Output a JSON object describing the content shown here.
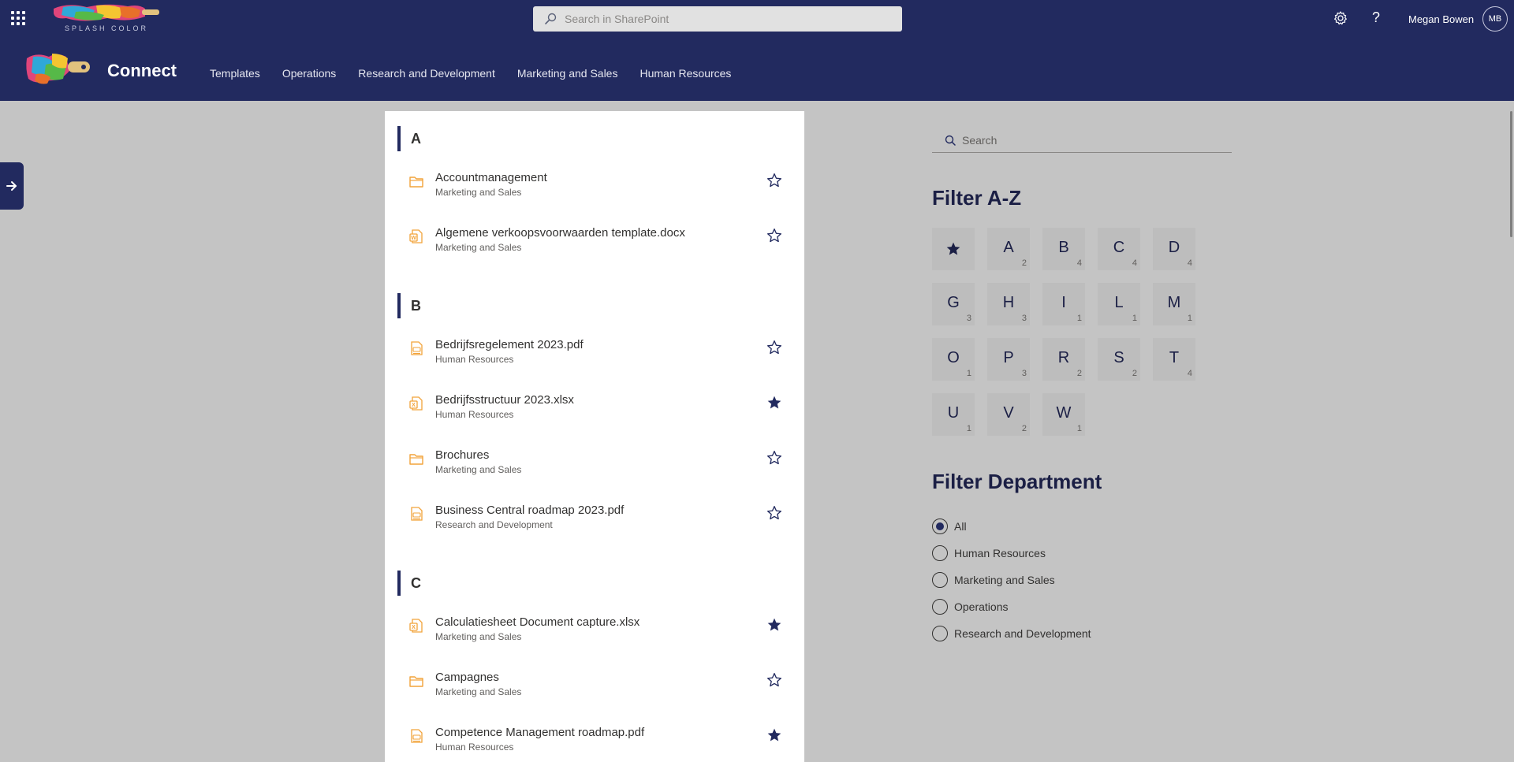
{
  "suite": {
    "brand": "SPLASH COLOR",
    "search_placeholder": "Search in SharePoint",
    "user_name": "Megan Bowen",
    "user_initials": "MB"
  },
  "site": {
    "title": "Connect",
    "nav": [
      "Templates",
      "Operations",
      "Research and Development",
      "Marketing and Sales",
      "Human Resources"
    ]
  },
  "colors": {
    "brand": "#222a5f",
    "file_icon": "#f2a33a",
    "page_bg": "#c4c4c4"
  },
  "groups": [
    {
      "letter": "A",
      "items": [
        {
          "name": "Accountmanagement",
          "dept": "Marketing and Sales",
          "icon": "folder-icon",
          "favorite": false
        },
        {
          "name": "Algemene verkoopsvoorwaarden template.docx",
          "dept": "Marketing and Sales",
          "icon": "word-doc-icon",
          "favorite": false
        }
      ]
    },
    {
      "letter": "B",
      "items": [
        {
          "name": "Bedrijfsregelement 2023.pdf",
          "dept": "Human Resources",
          "icon": "pdf-icon",
          "favorite": false
        },
        {
          "name": "Bedrijfsstructuur 2023.xlsx",
          "dept": "Human Resources",
          "icon": "excel-icon",
          "favorite": true
        },
        {
          "name": "Brochures",
          "dept": "Marketing and Sales",
          "icon": "folder-icon",
          "favorite": false
        },
        {
          "name": "Business Central roadmap 2023.pdf",
          "dept": "Research and Development",
          "icon": "pdf-icon",
          "favorite": false
        }
      ]
    },
    {
      "letter": "C",
      "items": [
        {
          "name": "Calculatiesheet Document capture.xlsx",
          "dept": "Marketing and Sales",
          "icon": "excel-icon",
          "favorite": true
        },
        {
          "name": "Campagnes",
          "dept": "Marketing and Sales",
          "icon": "folder-icon",
          "favorite": false
        },
        {
          "name": "Competence Management roadmap.pdf",
          "dept": "Human Resources",
          "icon": "pdf-icon",
          "favorite": true
        }
      ]
    }
  ],
  "filter": {
    "search_placeholder": "Search",
    "az_title": "Filter A-Z",
    "favorites_icon": "star-filled-icon",
    "letters": [
      {
        "letter": "A",
        "count": "2"
      },
      {
        "letter": "B",
        "count": "4"
      },
      {
        "letter": "C",
        "count": "4"
      },
      {
        "letter": "D",
        "count": "4"
      },
      {
        "letter": "G",
        "count": "3"
      },
      {
        "letter": "H",
        "count": "3"
      },
      {
        "letter": "I",
        "count": "1"
      },
      {
        "letter": "L",
        "count": "1"
      },
      {
        "letter": "M",
        "count": "1"
      },
      {
        "letter": "O",
        "count": "1"
      },
      {
        "letter": "P",
        "count": "3"
      },
      {
        "letter": "R",
        "count": "2"
      },
      {
        "letter": "S",
        "count": "2"
      },
      {
        "letter": "T",
        "count": "4"
      },
      {
        "letter": "U",
        "count": "1"
      },
      {
        "letter": "V",
        "count": "2"
      },
      {
        "letter": "W",
        "count": "1"
      }
    ],
    "dept_title": "Filter Department",
    "departments": [
      {
        "label": "All",
        "selected": true
      },
      {
        "label": "Human Resources",
        "selected": false
      },
      {
        "label": "Marketing and Sales",
        "selected": false
      },
      {
        "label": "Operations",
        "selected": false
      },
      {
        "label": "Research and Development",
        "selected": false
      }
    ]
  }
}
